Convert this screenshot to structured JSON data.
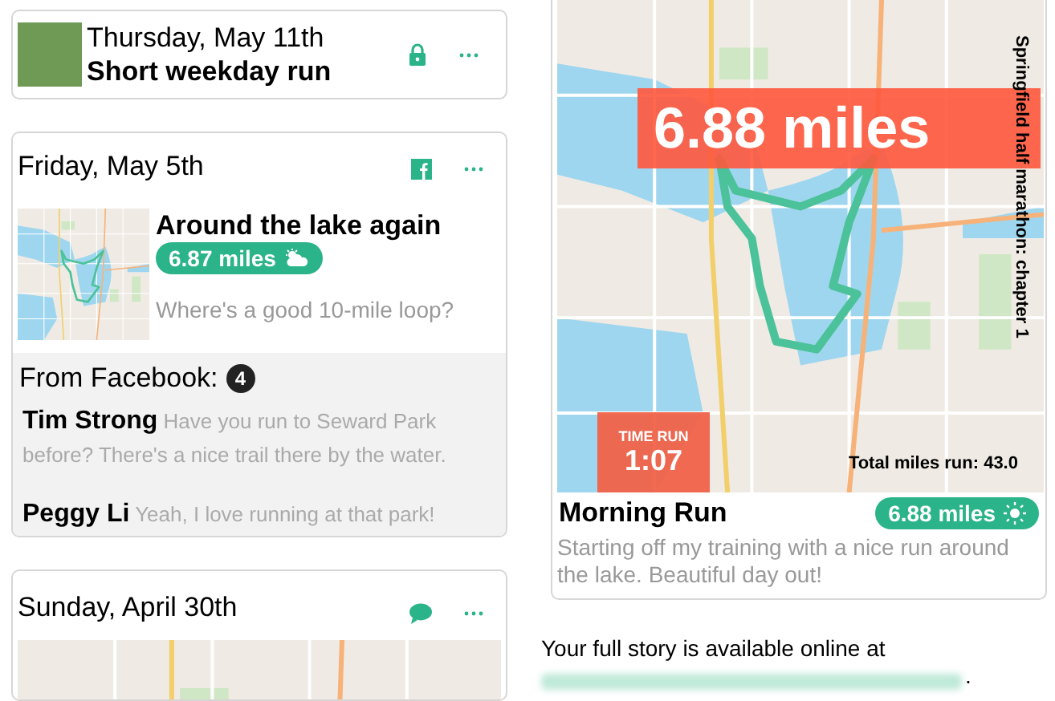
{
  "left_cards": [
    {
      "kind": "compact",
      "date": "Thursday, May 11th",
      "title": "Short weekday run"
    },
    {
      "kind": "detail",
      "date": "Friday, May 5th",
      "title": "Around the lake again",
      "distance": "6.87 miles",
      "question": "Where's a good 10-mile loop?",
      "comments_heading": "From Facebook:",
      "comment_count": "4",
      "comments": [
        {
          "name": "Tim Strong",
          "text": "Have you run to Seward Park before? There's a nice trail there by the water."
        },
        {
          "name": "Peggy Li",
          "text": "Yeah, I love running at that park!"
        }
      ]
    },
    {
      "kind": "map",
      "date": "Sunday, April 30th"
    }
  ],
  "story_card": {
    "banner": "6.88 miles",
    "series": "Springfield half marathon: chapter 1",
    "time_label": "TIME RUN",
    "time": "1:07",
    "total": "Total miles run: 43.0",
    "title": "Morning Run",
    "distance": "6.88 miles",
    "description": "Starting off my training with a nice run around the lake. Beautiful day out!"
  },
  "footer": {
    "text": "Your full story is available online at",
    "end": "."
  }
}
